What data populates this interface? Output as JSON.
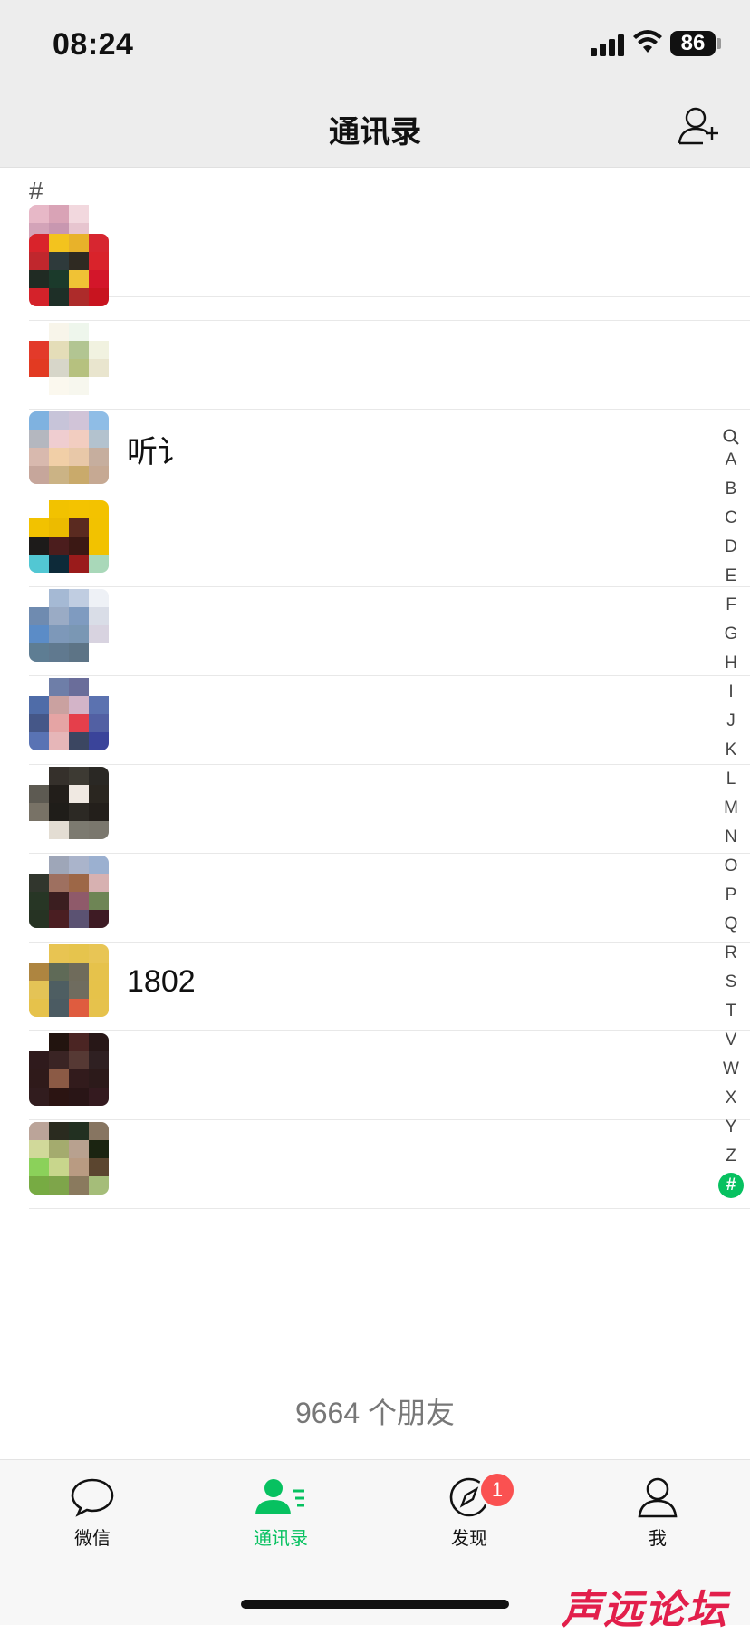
{
  "status": {
    "time": "08:24",
    "battery": "86",
    "icons": [
      "signal-icon",
      "wifi-icon",
      "battery-icon"
    ]
  },
  "nav": {
    "title": "通讯录",
    "add_icon": "add-friend-icon"
  },
  "section": {
    "letter": "#"
  },
  "contacts": [
    {
      "name": "",
      "avatar": [
        "#e7b8c7",
        "#d9a3b6",
        "#f2d8de",
        "#ffffff",
        "#d3a3b8",
        "#c897b0",
        "#e7c5cf",
        "#ffffff",
        "#ffffff",
        "#ffffff",
        "#ffffff",
        "#ffffff",
        "#ffffff",
        "#ffffff",
        "#ffffff",
        "#ffffff"
      ]
    },
    {
      "name": "",
      "avatar": [
        "#d9232b",
        "#f3c31e",
        "#e8b22a",
        "#d72630",
        "#c0272d",
        "#2e3a3b",
        "#2f2a22",
        "#d9232b",
        "#202b23",
        "#1b3a2b",
        "#f0c235",
        "#d3162a",
        "#d4222a",
        "#1e2f27",
        "#ad2b2a",
        "#c8141f"
      ]
    },
    {
      "name": "",
      "avatar": [
        "#ffffff",
        "#f8f5ea",
        "#eef6ec",
        "#ffffff",
        "#e33a2a",
        "#e4ddb8",
        "#b2c592",
        "#f1f2e0",
        "#e23a22",
        "#d7d6c9",
        "#b6c17f",
        "#e9e5ce",
        "#ffffff",
        "#fbf8ee",
        "#f7f7ee",
        "#ffffff"
      ]
    },
    {
      "name": "听讠",
      "avatar": [
        "#7fb2e0",
        "#c7c4d9",
        "#d1c4d8",
        "#8fbde6",
        "#b4b7bf",
        "#efcdd0",
        "#f2cdc0",
        "#b3c2ce",
        "#d8b9ae",
        "#f1cfa7",
        "#e8c8a8",
        "#c6ae9e",
        "#c6a69b",
        "#cbb385",
        "#c9aa6b",
        "#c6a993"
      ]
    },
    {
      "name": "",
      "avatar": [
        "#ffffff",
        "#f2c200",
        "#f4c300",
        "#f3c200",
        "#f2c200",
        "#ecbb00",
        "#5a2a20",
        "#f2c200",
        "#1d1b1a",
        "#4b1d1d",
        "#3b1814",
        "#f2c200",
        "#52c7d3",
        "#0d2a39",
        "#9a1b1b",
        "#a9d8b9"
      ]
    },
    {
      "name": "",
      "avatar": [
        "#ffffff",
        "#a5b9d4",
        "#c0cde1",
        "#eef1f6",
        "#6f8bb0",
        "#9aabc5",
        "#7f9bc0",
        "#d9dde7",
        "#5b8cc7",
        "#7d98b9",
        "#7a97b4",
        "#d8d3e0",
        "#5e7d93",
        "#60798f",
        "#5d7486",
        "#ffffff"
      ]
    },
    {
      "name": "",
      "avatar": [
        "#ffffff",
        "#6e7ea8",
        "#6a6d9a",
        "#ffffff",
        "#4f6ca8",
        "#caa1a0",
        "#d3b4c8",
        "#5b72b0",
        "#455788",
        "#e5a4a4",
        "#e53f4b",
        "#5260a3",
        "#5973b4",
        "#e6b6b8",
        "#3b4661",
        "#3a449a"
      ]
    },
    {
      "name": "",
      "avatar": [
        "#ffffff",
        "#35302b",
        "#3d3a33",
        "#2a2824",
        "#5d5a52",
        "#221e1a",
        "#f0e9e2",
        "#2a2620",
        "#787266",
        "#1f1d19",
        "#2c2924",
        "#231f1b",
        "#ffffff",
        "#e3ddd3",
        "#7c7a70",
        "#7a776d"
      ]
    },
    {
      "name": "",
      "avatar": [
        "#ffffff",
        "#9ea6b8",
        "#aab4cb",
        "#9bb0d0",
        "#31362d",
        "#9e7060",
        "#9d6747",
        "#d7b1b1",
        "#273625",
        "#3b1e20",
        "#8f5a6a",
        "#6e8555",
        "#263323",
        "#4a1e22",
        "#5b5272",
        "#3e1b24"
      ]
    },
    {
      "name": "1802",
      "avatar": [
        "#ffffff",
        "#e8c452",
        "#e6c44d",
        "#e8c555",
        "#ae8540",
        "#5f6a57",
        "#6f6b5b",
        "#e6c24b",
        "#e4c356",
        "#4e5e62",
        "#6f6c5f",
        "#e6c24a",
        "#e6c24b",
        "#4b5b62",
        "#df5c3f",
        "#e6c24c"
      ]
    },
    {
      "name": "",
      "avatar": [
        "#ffffff",
        "#22140f",
        "#4b2523",
        "#271717",
        "#2f1a1c",
        "#3a2424",
        "#563934",
        "#2f2022",
        "#2f1a1a",
        "#8b5a45",
        "#321b1c",
        "#2c1a1a",
        "#311c1e",
        "#2b1412",
        "#291516",
        "#341a1f"
      ]
    },
    {
      "name": "",
      "avatar": [
        "#bba499",
        "#2a2b1f",
        "#223021",
        "#877561",
        "#d1d99a",
        "#a4ab6e",
        "#b8a18f",
        "#1b2411",
        "#8bd15a",
        "#c8d68c",
        "#b99b82",
        "#5b452f",
        "#77ab43",
        "#7ea54a",
        "#8a7a5e",
        "#a5bd79"
      ]
    }
  ],
  "index_bar": [
    "A",
    "B",
    "C",
    "D",
    "E",
    "F",
    "G",
    "H",
    "I",
    "J",
    "K",
    "L",
    "M",
    "N",
    "O",
    "P",
    "Q",
    "R",
    "S",
    "T",
    "V",
    "W",
    "X",
    "Y",
    "Z",
    "#"
  ],
  "footer": {
    "count_text": "9664 个朋友"
  },
  "tabs": [
    {
      "label": "微信",
      "icon": "chat-bubble-icon",
      "active": false
    },
    {
      "label": "通讯录",
      "icon": "contacts-icon",
      "active": true
    },
    {
      "label": "发现",
      "icon": "compass-icon",
      "active": false,
      "badge": "1"
    },
    {
      "label": "我",
      "icon": "person-icon",
      "active": false
    }
  ],
  "colors": {
    "accent": "#07c160",
    "badge": "#fa5151",
    "nav_bg": "#ededed"
  },
  "watermark": "声远论坛"
}
